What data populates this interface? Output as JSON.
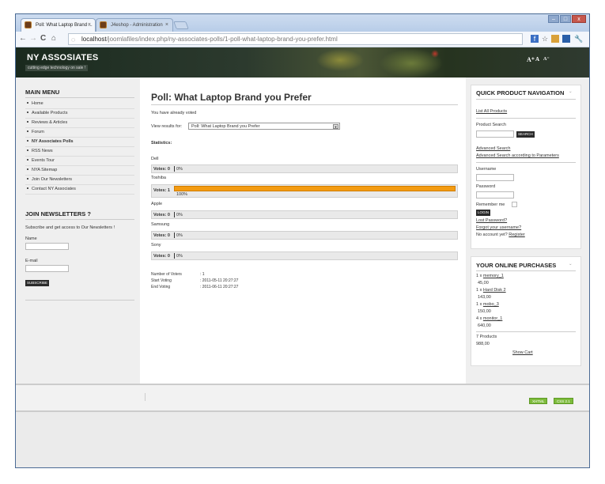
{
  "browser": {
    "tabs": [
      {
        "label": "Poll: What Laptop Brand ..."
      },
      {
        "label": "J4eshop - Administration"
      }
    ],
    "url": {
      "host": "localhost",
      "path": "/joomlafiles/index.php/ny-associates-polls/1-poll-what-laptop-brand-you-prefer.html"
    }
  },
  "site": {
    "name": "NY ASSOSIATES",
    "slogan": "cutting edge technology on sale !",
    "resizer": [
      "A⁺",
      "A",
      "A⁻"
    ]
  },
  "main_menu": {
    "title": "MAIN MENU",
    "items": [
      "Home",
      "Available Products",
      "Reviews & Articles",
      "Forum",
      "NY Associates Polls",
      "RSS News",
      "Events Tour",
      "NYA Sitemap",
      "Join Our Newsletters",
      "Contact NY Associates"
    ]
  },
  "newsletter": {
    "title": "JOIN NEWSLETTERS ?",
    "intro": "Subscribe and get access to Our Newsletters !",
    "name_label": "Name",
    "email_label": "E-mail",
    "subscribe": "SUBSCRIBE"
  },
  "poll": {
    "title": "Poll: What Laptop Brand you Prefer",
    "voted_msg": "You have already voted",
    "view_label": "View results for:",
    "select_value": "Poll: What Laptop Brand you Prefer",
    "stats_title": "Statistics:",
    "options": [
      {
        "name": "Dell",
        "votes_label": "Votes: 0",
        "percent": 0,
        "pct_label": "0%"
      },
      {
        "name": "Toshiba",
        "votes_label": "Votes: 1",
        "percent": 100,
        "pct_label": "100%"
      },
      {
        "name": "Apple",
        "votes_label": "Votes: 0",
        "percent": 0,
        "pct_label": "0%"
      },
      {
        "name": "Samsung",
        "votes_label": "Votes: 0",
        "percent": 0,
        "pct_label": "0%"
      },
      {
        "name": "Sony",
        "votes_label": "Votes: 0",
        "percent": 0,
        "pct_label": "0%"
      }
    ],
    "stats": [
      {
        "label": "Number of Voters",
        "value": ": 1"
      },
      {
        "label": "Start Voting",
        "value": ": 2011-05-11 20:27:27"
      },
      {
        "label": "End Voting",
        "value": ": 2011-06-11 20:27:27"
      }
    ]
  },
  "quick_nav": {
    "title": "QUICK PRODUCT NAVIGATION",
    "list_all": "List All Products",
    "product_search": "Product Search",
    "search_btn": "SEARCH",
    "adv_search": "Advanced Search",
    "adv_search_params": "Advanced Search according to Parameters",
    "username": "Username",
    "password": "Password",
    "remember": "Remember me",
    "login": "LOGIN",
    "lost_password": "Lost Password?",
    "forgot_username": "Forgot your username?",
    "no_account": "No account yet?",
    "register": "Register"
  },
  "purchases": {
    "title": "YOUR ONLINE PURCHASES",
    "items": [
      {
        "qty": "1 x",
        "name": "memory_1",
        "price": "45,00"
      },
      {
        "qty": "1 x",
        "name": "Hard Disk 2",
        "price": "143,00"
      },
      {
        "qty": "1 x",
        "name": "mobo_3",
        "price": "150,00"
      },
      {
        "qty": "4 x",
        "name": "monitor_1",
        "price": "640,00"
      }
    ],
    "total_count": "7 Products",
    "total": "988,00",
    "show_cart": "Show Cart"
  },
  "footer": {
    "badges": [
      "XHTML",
      "CSS 2.1"
    ]
  },
  "colors": {
    "accent": "#f39b12",
    "header_bg": "#26331f",
    "badge": "#7dbb3c"
  }
}
